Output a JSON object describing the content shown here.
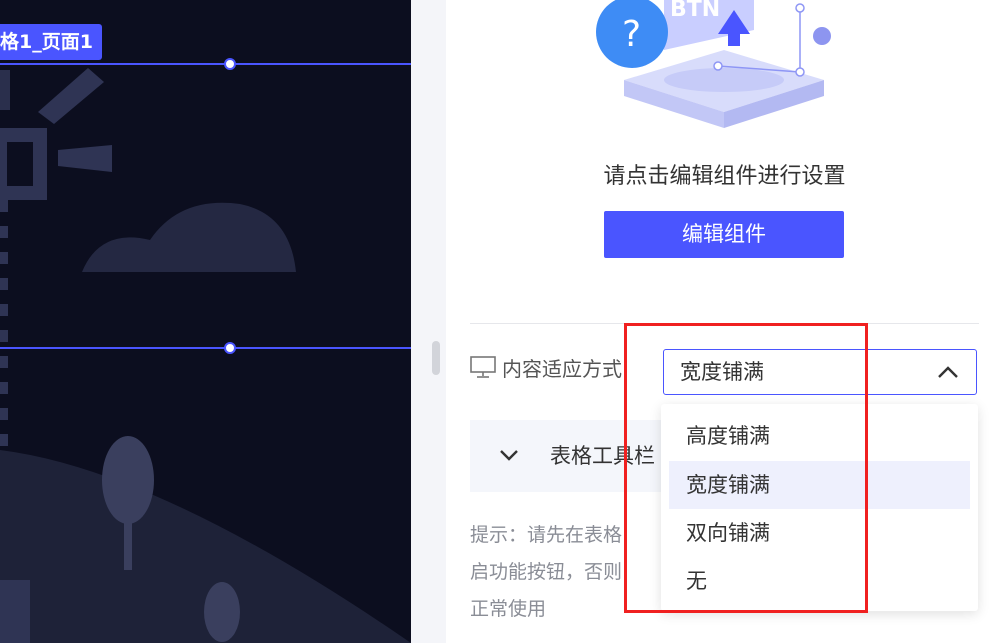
{
  "canvas": {
    "page_label": "格1_页面1"
  },
  "panel": {
    "illustration": {
      "question_mark": "?",
      "badge_text": "BTN"
    },
    "hint_text": "请点击编辑组件进行设置",
    "edit_button_label": "编辑组件",
    "fit_mode": {
      "icon": "monitor-icon",
      "label": "内容适应方式",
      "selected_value": "宽度铺满",
      "options": [
        "高度铺满",
        "宽度铺满",
        "双向铺满",
        "无"
      ]
    },
    "collapse": {
      "label": "表格工具栏"
    },
    "tip_lines": [
      "提示：请先在表格",
      "启功能按钮，否则",
      "正常使用"
    ]
  },
  "colors": {
    "accent": "#4a55ff",
    "highlight": "#f02020",
    "canvas_bg": "#0c0e1f"
  }
}
